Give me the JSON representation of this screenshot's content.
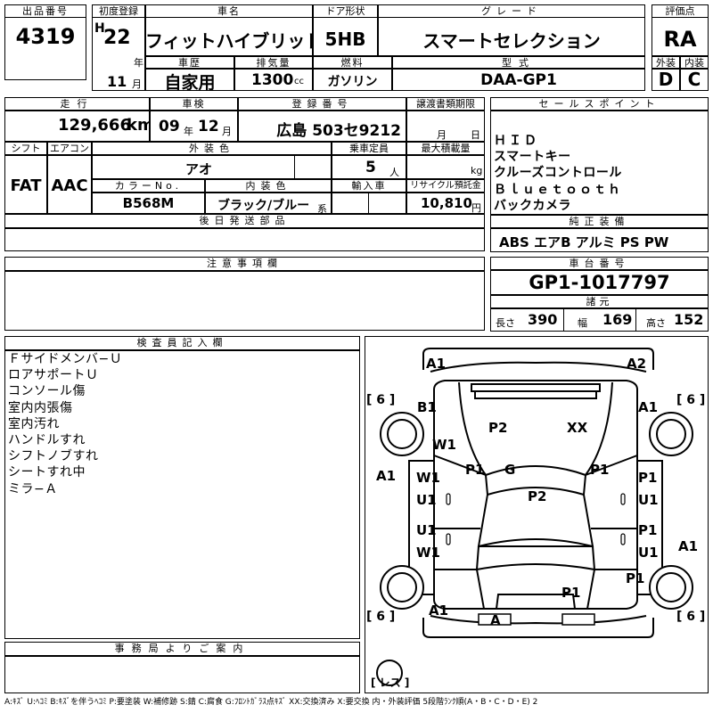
{
  "header": {
    "lot_no_label": "出品番号",
    "lot_no": "4319",
    "first_reg_label": "初度登録",
    "era_mark": "H",
    "first_reg_year": "22",
    "year_unit": "年",
    "first_reg_month": "11",
    "month_unit": "月",
    "car_name_label": "車名",
    "car_name": "フィットハイブリッド",
    "door_label": "ドア形状",
    "door": "5HB",
    "grade_label": "グレード",
    "grade": "スマートセレクション",
    "score_label": "評価点",
    "score": "RA",
    "history_label": "車歴",
    "history": "自家用",
    "displacement_label": "排気量",
    "displacement": "1300",
    "displacement_unit": "cc",
    "fuel_label": "燃料",
    "fuel": "ガソリン",
    "model_label": "型式",
    "model": "DAA-GP1",
    "exterior_label": "外装",
    "exterior": "D",
    "interior_label": "内装",
    "interior": "C"
  },
  "row2": {
    "mileage_label": "走行",
    "mileage": "129,666",
    "mileage_unit": "km",
    "inspection_label": "車検",
    "inspection_year": "09",
    "inspection_month": "12",
    "year_unit": "年",
    "month_unit": "月",
    "plate_label": "登録番号",
    "plate": "広島 503セ9212",
    "transfer_label": "譲渡書類期限",
    "transfer_month": "月",
    "transfer_day": "日",
    "shift_label": "シフト",
    "shift": "FAT",
    "ac_label": "エアコン",
    "ac": "AAC",
    "ext_color_label": "外装色",
    "ext_color": "アオ",
    "capacity_label": "乗車定員",
    "capacity": "5",
    "capacity_unit": "人",
    "max_load_label": "最大積載量",
    "max_load_unit": "kg",
    "color_no_label": "カラーNo.",
    "color_no": "B568M",
    "int_color_label": "内装色",
    "int_color": "ブラック/ブルー",
    "int_color_suffix": "系",
    "import_label": "輸入車",
    "recycle_label": "リサイクル預託金",
    "recycle": "10,810",
    "recycle_unit": "円"
  },
  "later_parts_label": "後日発送部品",
  "notes_label": "注意事項欄",
  "sales_points": {
    "label": "セールスポイント",
    "lines": [
      "ＨＩＤ",
      "スマートキー",
      "クルーズコントロール",
      "Ｂｌｕｅｔｏｏｔｈ",
      "バックカメラ"
    ]
  },
  "equipment": {
    "label": "純正装備",
    "value": "ABS エアB アルミ PS PW"
  },
  "chassis": {
    "label": "車台番号",
    "value": "GP1-1017797"
  },
  "specs": {
    "label": "諸元",
    "length_label": "長さ",
    "length": "390",
    "width_label": "幅",
    "width": "169",
    "height_label": "高さ",
    "height": "152"
  },
  "inspector": {
    "label": "検査員記入欄",
    "lines": [
      "Ｆサイドメンバ−Ｕ",
      "ロアサポートＵ",
      "コンソール傷",
      "室内内張傷",
      "室内汚れ",
      "ハンドルすれ",
      "シフトノブすれ",
      "シートすれ中",
      "ミラ−Ａ"
    ]
  },
  "diagram": {
    "marks": {
      "front_left": "A1",
      "front_right": "A2",
      "tire_fl": "[ 6 ]",
      "tire_fr": "[ 6 ]",
      "fender_left": "B1",
      "fender_right": "A1",
      "mirror_left": "W1",
      "hood_left": "P2",
      "hood_right": "XX",
      "pillar_left": "P1",
      "windshield": "G",
      "pillar_right": "P1",
      "door_fl_1": "W1",
      "door_fl_2": "U1",
      "door_fr_1": "P1",
      "door_fr_2": "U1",
      "side_left": "A1",
      "roof": "P2",
      "door_rl_1": "U1",
      "door_rl_2": "W1",
      "door_rr_1": "P1",
      "door_rr_2": "U1",
      "side_right": "A1",
      "qtr_right": "P1",
      "trunk": "P1",
      "rear_left": "A1",
      "rear_bumper": "A",
      "tire_rl": "[ 6 ]",
      "tire_rr": "[ 6 ]",
      "spare": "[ レス ]"
    }
  },
  "office_label": "事務局よりご案内",
  "legend": "A:ｷｽﾞ U:ﾍｺﾐ B:ｷｽﾞを伴うﾍｺﾐ P:要塗装 W:補修跡 S:錆 C:腐食 G:ﾌﾛﾝﾄｶﾞﾗｽ点ｷｽﾞ XX:交換済み X:要交換 内・外装評価 5段階ﾗﾝｸ順(A・B・C・D・E) 2"
}
